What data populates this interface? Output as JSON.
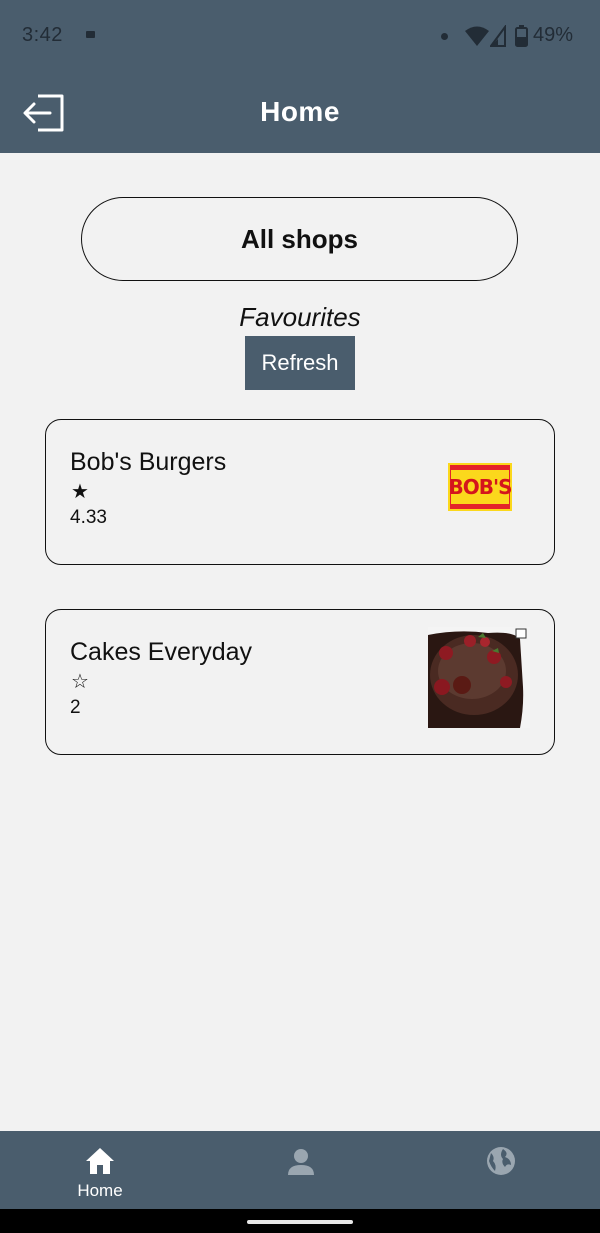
{
  "status_bar": {
    "time": "3:42",
    "battery_percent": "49%"
  },
  "app_bar": {
    "title": "Home",
    "logout_icon": "logout-icon"
  },
  "main": {
    "all_shops_label": "All shops",
    "favourites_label": "Favourites",
    "refresh_label": "Refresh"
  },
  "shops": [
    {
      "name": "Bob's Burgers",
      "star": "★",
      "rating": "4.33",
      "logo_text": "BOB'S"
    },
    {
      "name": "Cakes Everyday",
      "star": "☆",
      "rating": "2"
    }
  ],
  "bottom_nav": {
    "home_label": "Home",
    "icons": [
      "home-icon",
      "profile-icon",
      "globe-icon"
    ]
  },
  "colors": {
    "app_bar": "#4a5d6d",
    "background": "#f2f2f2",
    "active_nav": "#ffffff",
    "inactive_nav": "#9aa6b0"
  }
}
